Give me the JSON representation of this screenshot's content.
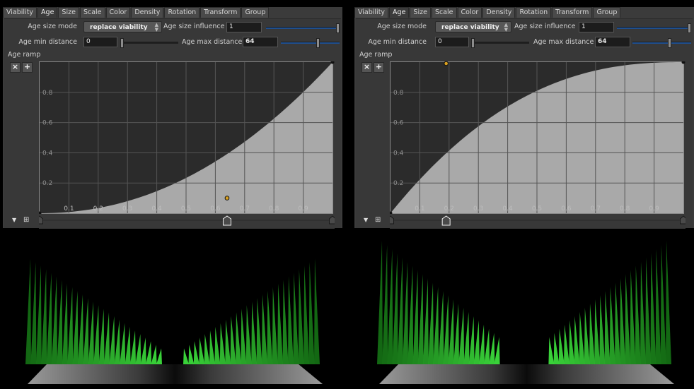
{
  "tabs": [
    "Viability",
    "Age",
    "Size",
    "Scale",
    "Color",
    "Density",
    "Rotation",
    "Transform",
    "Group"
  ],
  "active_tab": "Age",
  "labels": {
    "age_size_mode": "Age size mode",
    "age_size_influence": "Age size influence",
    "age_min_distance": "Age min distance",
    "age_max_distance": "Age max distance",
    "age_ramp": "Age ramp"
  },
  "x_ticks": [
    "0.1",
    "0.2",
    "0.3",
    "0.4",
    "0.5",
    "0.6",
    "0.7",
    "0.8",
    "0.9"
  ],
  "y_ticks": [
    "0.2",
    "0.4",
    "0.6",
    "0.8"
  ],
  "ramp_buttons": {
    "remove": "×",
    "add": "+"
  },
  "panels": [
    {
      "age_size_mode": "replace viability",
      "age_size_influence": "1",
      "influence_level": 1.0,
      "age_min_distance": "0",
      "min_level": 0.0,
      "age_max_distance": "64",
      "max_level": 0.64,
      "curve": "ease-in",
      "selected_point": [
        0.64,
        0.1
      ]
    },
    {
      "age_size_mode": "replace viability",
      "age_size_influence": "1",
      "influence_level": 1.0,
      "age_min_distance": "0",
      "min_level": 0.0,
      "age_max_distance": "64",
      "max_level": 0.64,
      "curve": "ease-out",
      "selected_point": [
        0.19,
        1.0
      ]
    }
  ],
  "colors": {
    "curve_fill": "#a9a9a9",
    "plot_bg": "#2b2b2b",
    "grid": "#555555",
    "grass": "#1f9a1f",
    "selected_point": "#d9a020"
  }
}
